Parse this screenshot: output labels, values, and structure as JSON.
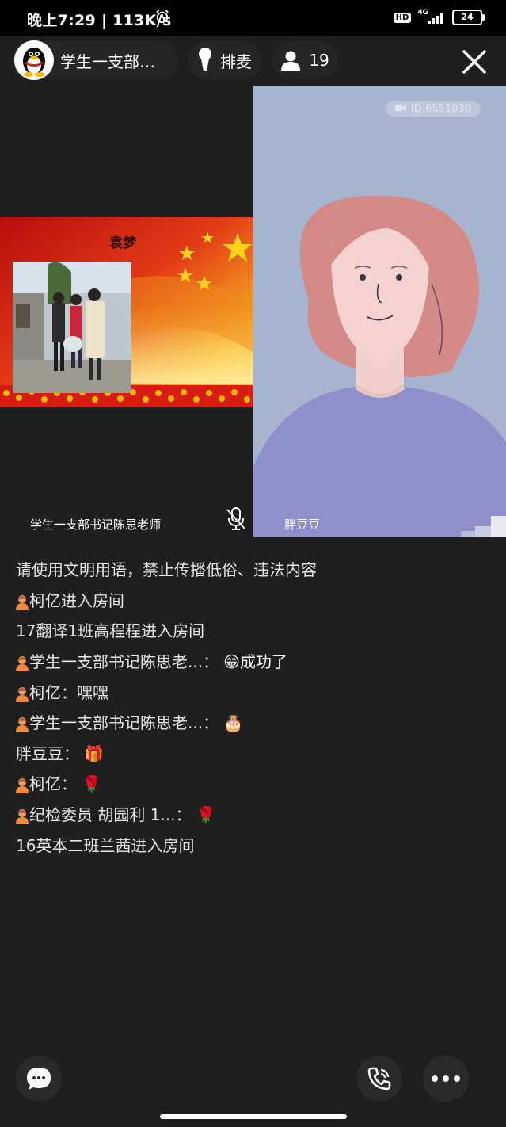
{
  "status_bar": {
    "time": "晚上7:29 | 113K/s",
    "hd": "HD",
    "network": "4G",
    "battery": "24"
  },
  "header": {
    "room_name": "学生一支部…",
    "queue_label": "排麦",
    "member_count": "19"
  },
  "video": {
    "left_tile": {
      "slide_title": "袁梦",
      "speaker_name": "学生一支部书记陈思老师"
    },
    "right_tile": {
      "id_label": "ID:6551030",
      "speaker_name": "胖豆豆"
    }
  },
  "chat": {
    "notice": "请使用文明用语，禁止传播低俗、违法内容",
    "messages": [
      {
        "user_icon": true,
        "text": "柯亿进入房间",
        "emoji": ""
      },
      {
        "user_icon": false,
        "text": "17翻译1班高程程进入房间",
        "emoji": ""
      },
      {
        "user_icon": true,
        "text": "学生一支部书记陈思老...：",
        "emoji": "😁",
        "extra": "成功了"
      },
      {
        "user_icon": true,
        "text": "柯亿：嘿嘿",
        "emoji": ""
      },
      {
        "user_icon": true,
        "text": "学生一支部书记陈思老...：",
        "emoji": "🎂"
      },
      {
        "user_icon": false,
        "text": "胖豆豆：",
        "emoji": "🎁"
      },
      {
        "user_icon": true,
        "text": "柯亿：",
        "emoji": "🌹"
      },
      {
        "user_icon": true,
        "text": "纪检委员 胡园利 1...：",
        "emoji": "🌹"
      },
      {
        "user_icon": false,
        "text": "16英本二班兰茜进入房间",
        "emoji": ""
      }
    ]
  },
  "colors": {
    "background": "#1f1f1f",
    "pill": "#262626",
    "right_tile_bg": "#a7b4cf"
  }
}
